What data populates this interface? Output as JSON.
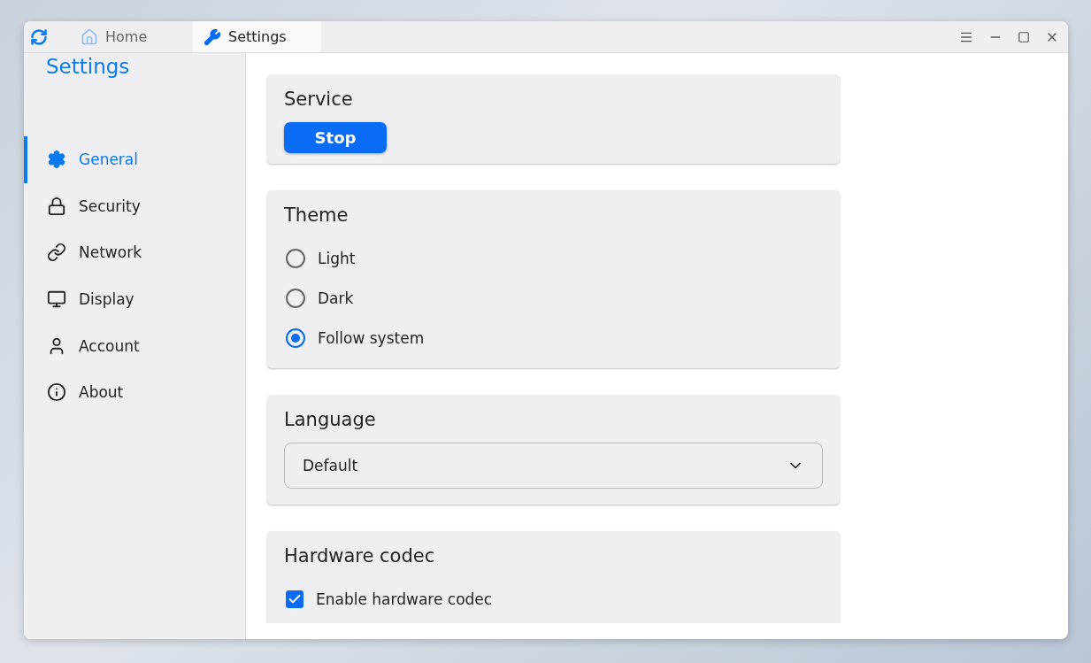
{
  "tabs": [
    {
      "label": "Home",
      "selected": false
    },
    {
      "label": "Settings",
      "selected": true
    }
  ],
  "sidebar": {
    "title": "Settings",
    "items": [
      {
        "label": "General",
        "selected": true
      },
      {
        "label": "Security",
        "selected": false
      },
      {
        "label": "Network",
        "selected": false
      },
      {
        "label": "Display",
        "selected": false
      },
      {
        "label": "Account",
        "selected": false
      },
      {
        "label": "About",
        "selected": false
      }
    ]
  },
  "sections": [
    {
      "kind": "button",
      "title": "Service",
      "button": "Stop"
    },
    {
      "kind": "radio",
      "title": "Theme",
      "options": [
        {
          "label": "Light",
          "selected": false
        },
        {
          "label": "Dark",
          "selected": false
        },
        {
          "label": "Follow system",
          "selected": true
        }
      ]
    },
    {
      "kind": "select",
      "title": "Language",
      "value": "Default"
    },
    {
      "kind": "checkbox",
      "title": "Hardware codec",
      "options": [
        {
          "label": "Enable hardware codec",
          "checked": true
        }
      ]
    }
  ]
}
